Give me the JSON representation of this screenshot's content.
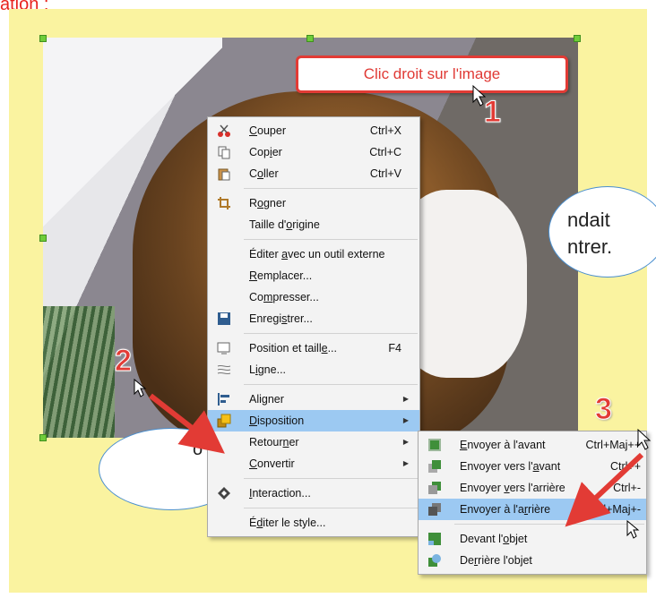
{
  "top_text": "ation :",
  "callout_text": "Clic droit sur l'image",
  "steps": [
    "1",
    "2",
    "3"
  ],
  "bubble1": {
    "line1": "ndait",
    "line2": "ntrer."
  },
  "bubble2": {
    "text": "o"
  },
  "context_menu": [
    {
      "label": "Couper",
      "shortcut": "Ctrl+X",
      "icon": "scissors-icon"
    },
    {
      "label": "Copier",
      "shortcut": "Ctrl+C",
      "icon": "copy-icon"
    },
    {
      "label": "Coller",
      "shortcut": "Ctrl+V",
      "icon": "paste-icon"
    },
    {
      "label": "Rogner",
      "shortcut": "",
      "icon": "crop-icon"
    },
    {
      "label": "Taille d'origine",
      "shortcut": "",
      "icon": ""
    },
    {
      "label": "Éditer avec un outil externe",
      "shortcut": "",
      "icon": ""
    },
    {
      "label": "Remplacer...",
      "shortcut": "",
      "icon": ""
    },
    {
      "label": "Compresser...",
      "shortcut": "",
      "icon": ""
    },
    {
      "label": "Enregistrer...",
      "shortcut": "",
      "icon": "save-icon"
    },
    {
      "label": "Position et taille...",
      "shortcut": "F4",
      "icon": "position-size-icon"
    },
    {
      "label": "Ligne...",
      "shortcut": "",
      "icon": "line-icon"
    },
    {
      "label": "Aligner",
      "shortcut": "",
      "icon": "align-icon"
    },
    {
      "label": "Disposition",
      "shortcut": "",
      "icon": "arrange-icon"
    },
    {
      "label": "Retourner",
      "shortcut": "",
      "icon": ""
    },
    {
      "label": "Convertir",
      "shortcut": "",
      "icon": ""
    },
    {
      "label": "Interaction...",
      "shortcut": "",
      "icon": "interaction-icon"
    },
    {
      "label": "Éditer le style...",
      "shortcut": "",
      "icon": ""
    }
  ],
  "submenu": [
    {
      "label": "Envoyer à l'avant",
      "shortcut": "Ctrl+Maj++",
      "icon": "bring-to-front-icon"
    },
    {
      "label": "Envoyer vers l'avant",
      "shortcut": "Ctrl++",
      "icon": "bring-forward-icon"
    },
    {
      "label": "Envoyer vers l'arrière",
      "shortcut": "Ctrl+-",
      "icon": "send-backward-icon"
    },
    {
      "label": "Envoyer à l'arrière",
      "shortcut": "Ctrl+Maj+-",
      "icon": "send-to-back-icon"
    },
    {
      "label": "Devant l'objet",
      "shortcut": "",
      "icon": "in-front-of-object-icon"
    },
    {
      "label": "Derrière l'objet",
      "shortcut": "",
      "icon": "behind-object-icon"
    }
  ],
  "colors": {
    "highlight": "#9cc9f2",
    "annotation_red": "#e23b35",
    "slide_bg": "#faf3a0"
  }
}
